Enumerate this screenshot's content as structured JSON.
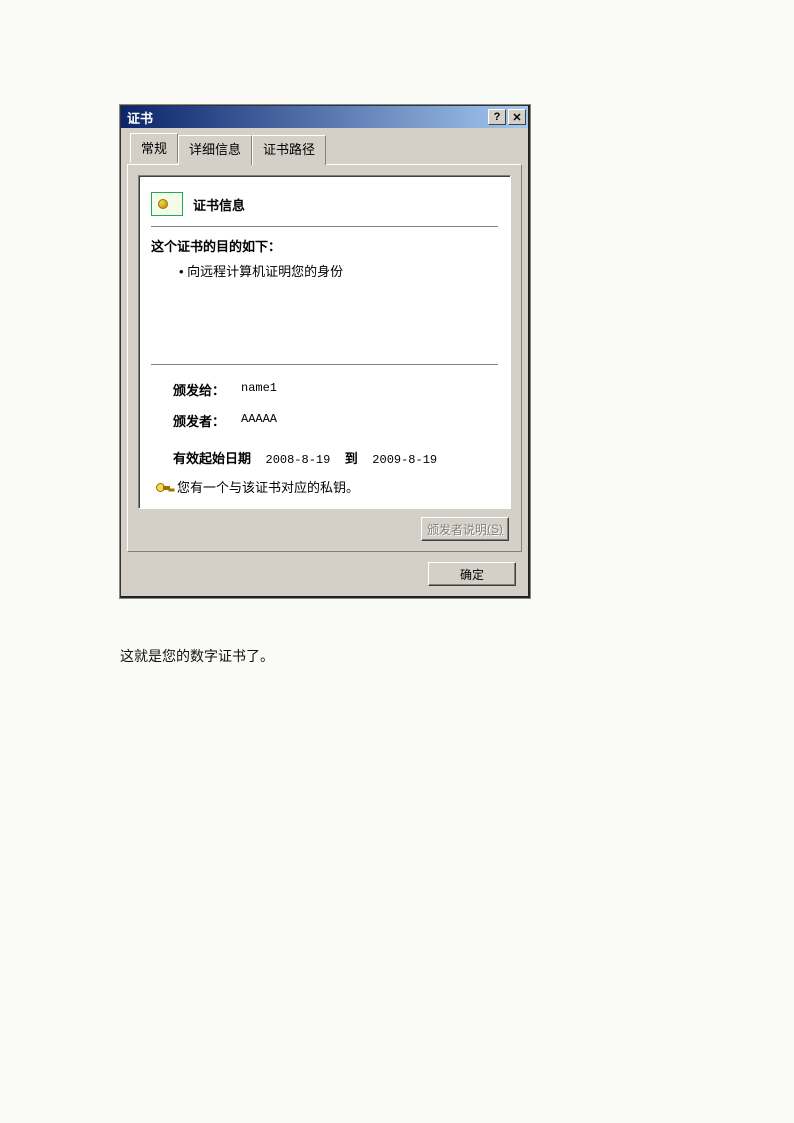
{
  "window": {
    "title": "证书",
    "help_btn": "?",
    "close_btn": "✕"
  },
  "tabs": {
    "general": "常规",
    "details": "详细信息",
    "path": "证书路径"
  },
  "cert": {
    "info_title": "证书信息",
    "purpose_title": "这个证书的目的如下：",
    "purpose_1": "• 向远程计算机证明您的身份",
    "issued_to_label": "颁发给：",
    "issued_to_value": "name1",
    "issuer_label": "颁发者：",
    "issuer_value": "AAAAA",
    "valid_from_label": "有效起始日期",
    "valid_from_value": "2008-8-19",
    "valid_to_label": "到",
    "valid_to_value": "2009-8-19",
    "private_key_msg": "您有一个与该证书对应的私钥。"
  },
  "buttons": {
    "issuer_statement": "颁发者说明",
    "issuer_statement_hotkey": "(S)",
    "ok": "确定"
  },
  "caption": "这就是您的数字证书了。"
}
